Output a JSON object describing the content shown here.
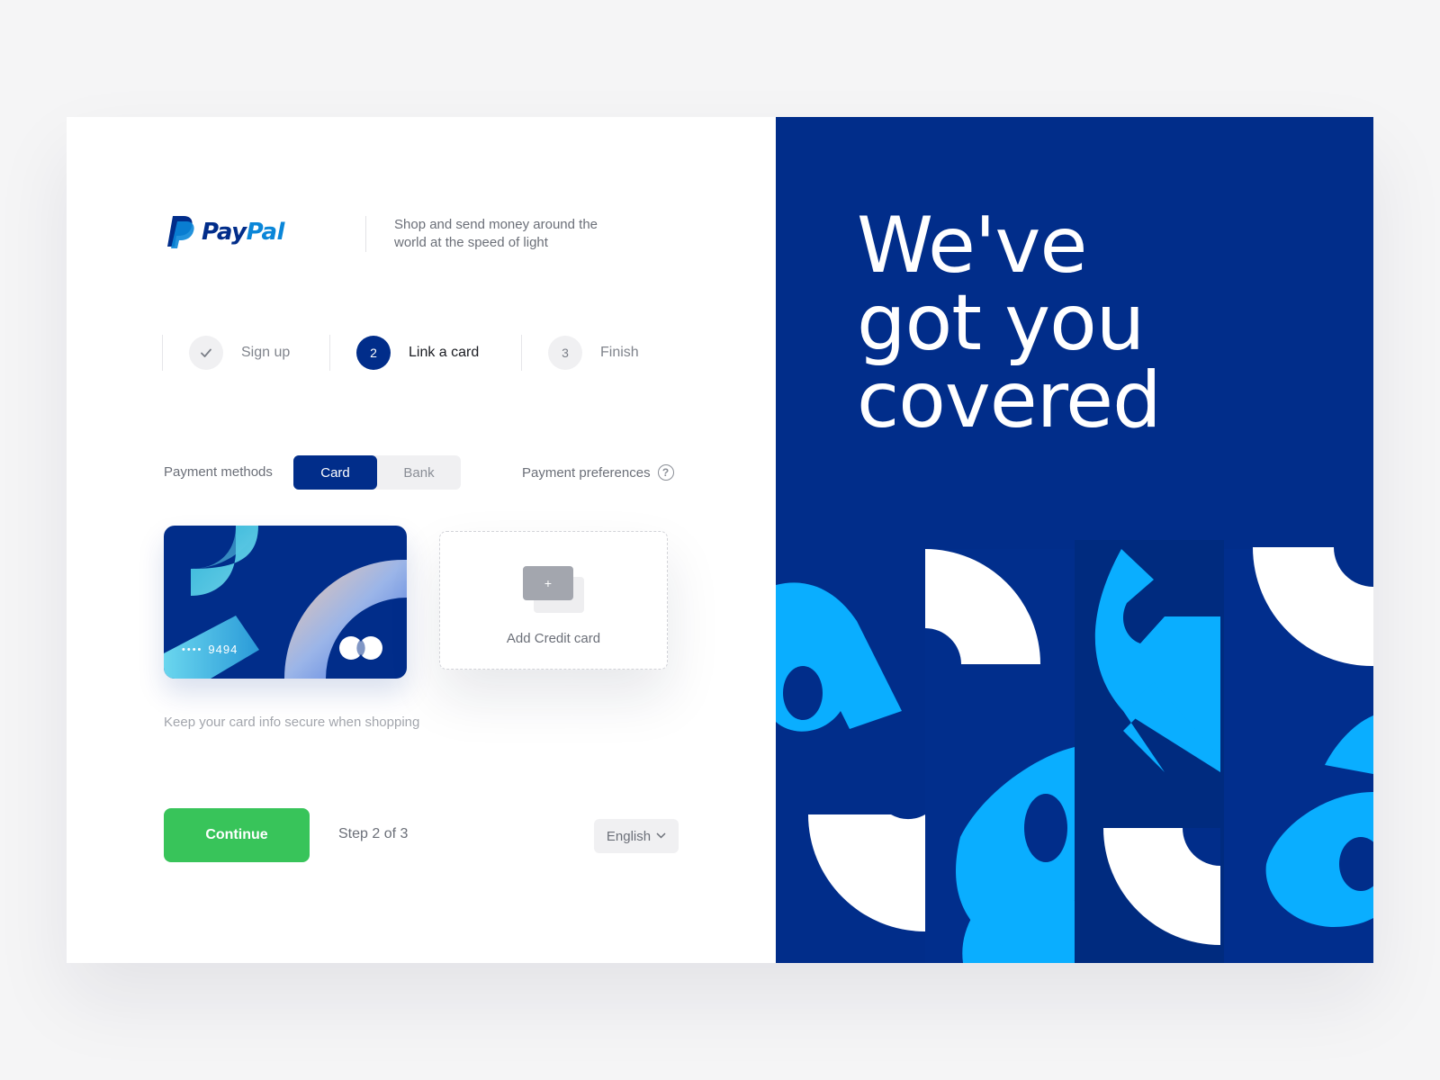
{
  "brand": {
    "name_part1": "Pay",
    "name_part2": "Pal",
    "tagline": "Shop and send money around the world at the speed of light"
  },
  "stepper": {
    "steps": [
      {
        "label": "Sign up",
        "state": "done",
        "icon": "check-icon"
      },
      {
        "label": "Link a card",
        "number": "2",
        "state": "active"
      },
      {
        "label": "Finish",
        "number": "3",
        "state": "todo"
      }
    ]
  },
  "payment": {
    "methods_label": "Payment methods",
    "tabs": [
      {
        "label": "Card",
        "selected": true
      },
      {
        "label": "Bank",
        "selected": false
      }
    ],
    "preferences_label": "Payment preferences",
    "help_icon": "question-circle-icon"
  },
  "card": {
    "masked": "••••",
    "last4": "9494",
    "brand_icon": "mastercard-icon"
  },
  "add_card": {
    "label": "Add Credit card",
    "icon": "plus-card-icon",
    "plus": "+"
  },
  "hint": "Keep your card info secure when shopping",
  "footer": {
    "continue_label": "Continue",
    "step_text": "Step 2 of 3",
    "language": "English",
    "chevron": "chevron-down-icon"
  },
  "hero": {
    "lines": [
      "We've",
      "got you",
      "covered"
    ]
  },
  "colors": {
    "navy": "#012d8a",
    "brand_light": "#0a86d8",
    "green": "#38c45a",
    "sky": "#0aaeff"
  }
}
